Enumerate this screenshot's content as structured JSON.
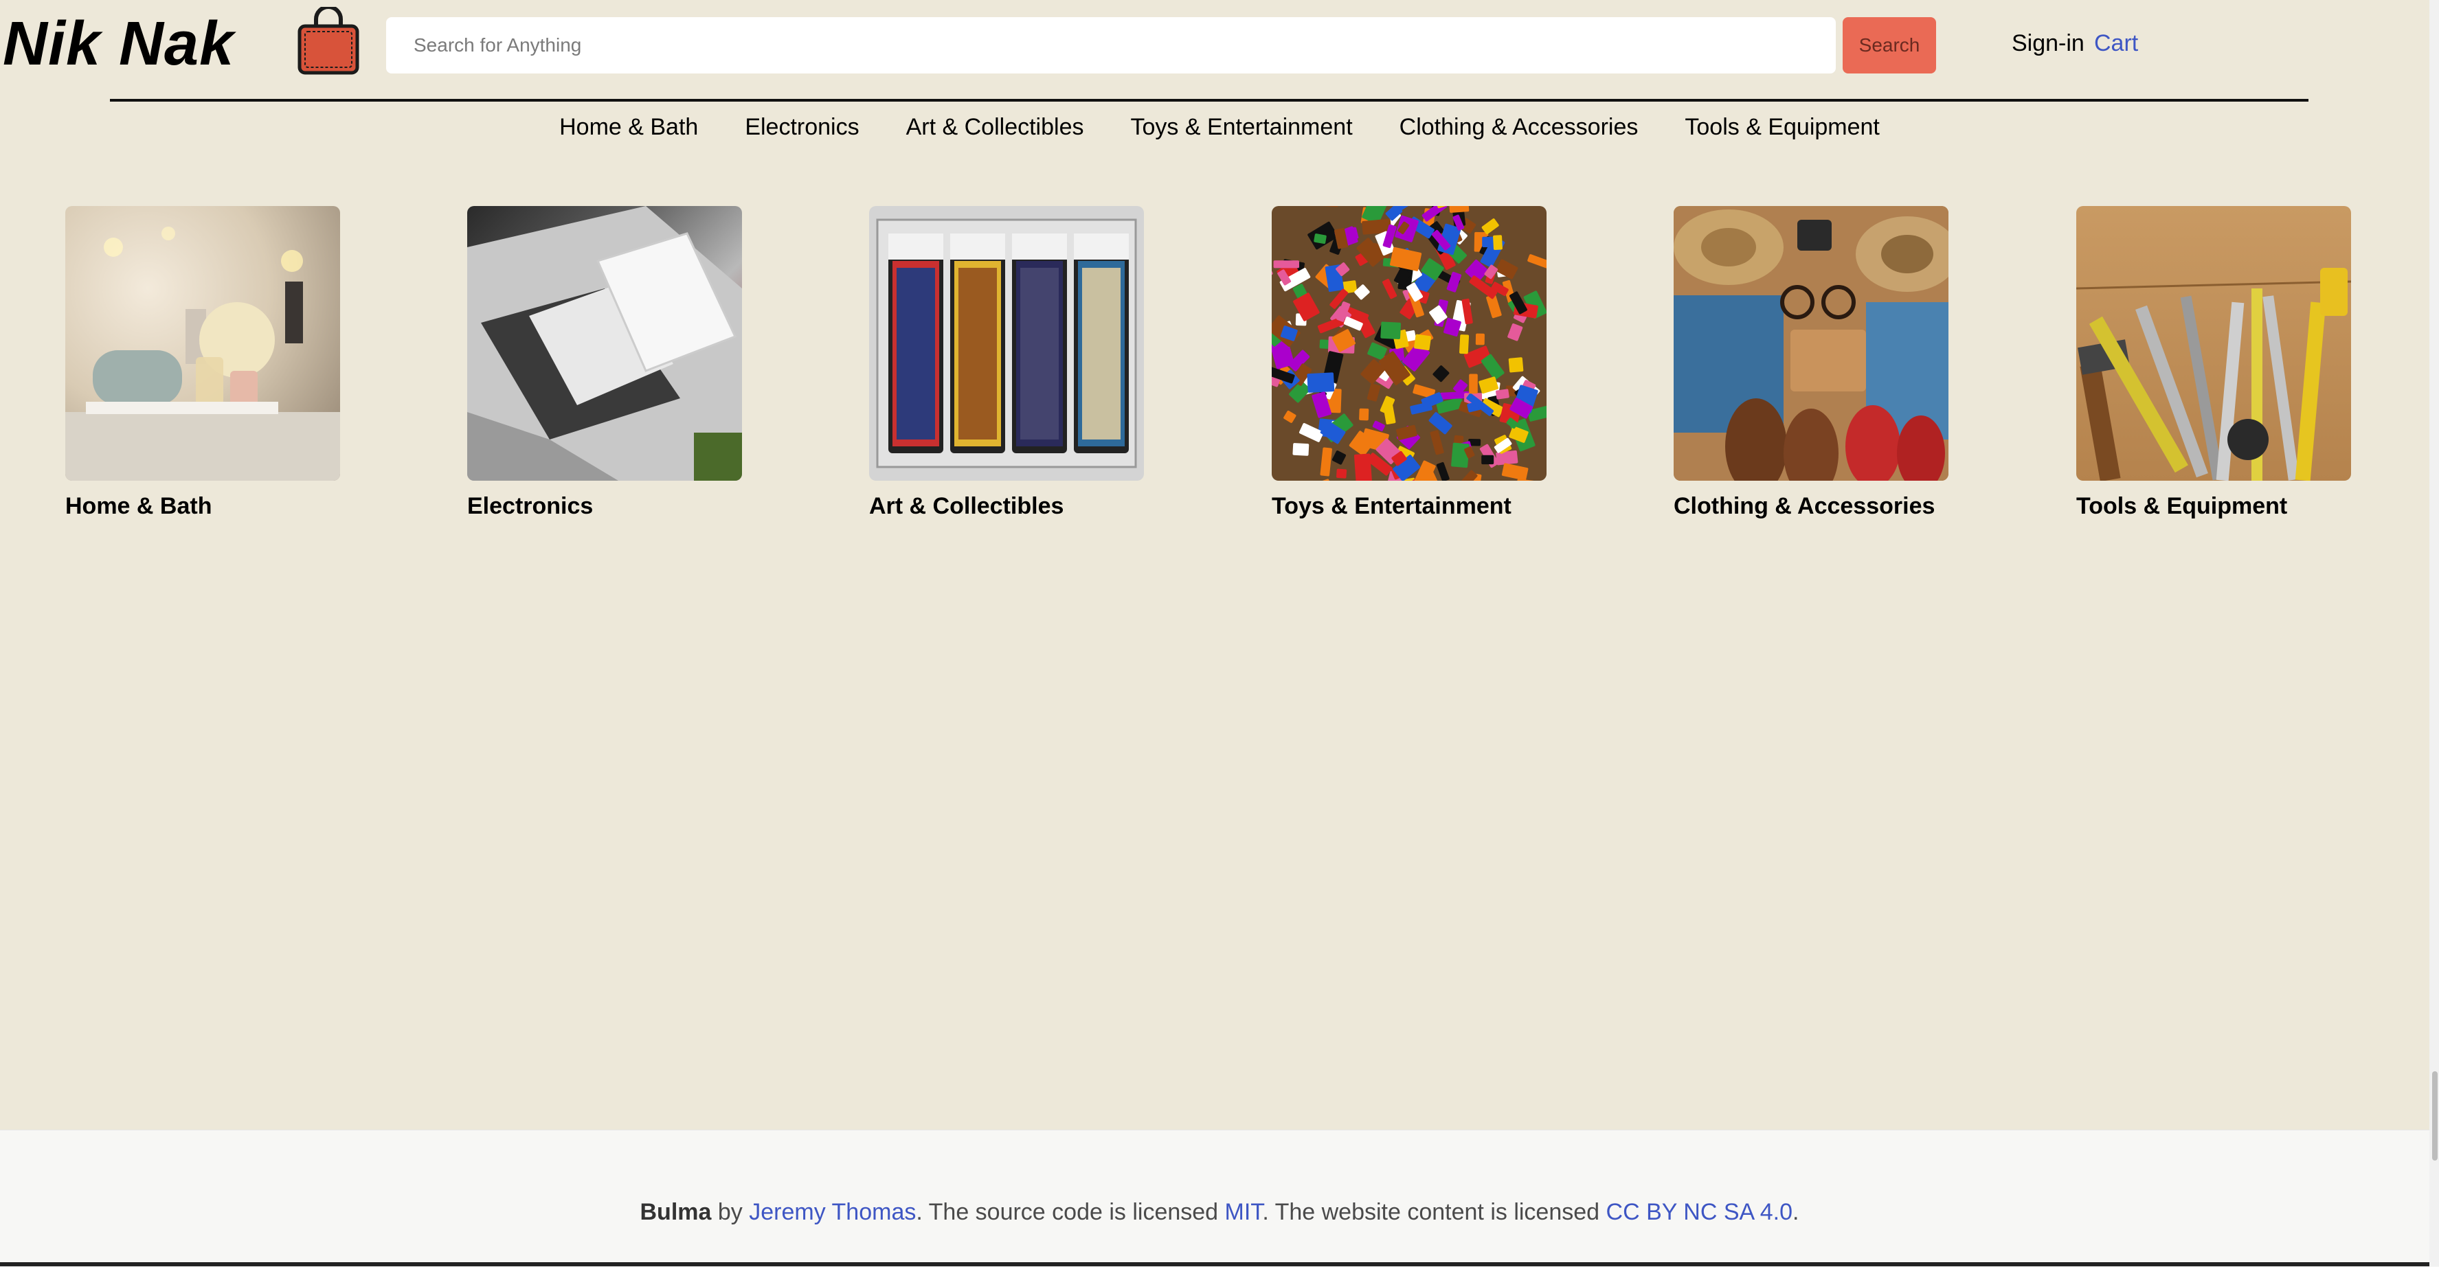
{
  "brand": {
    "name": "Nik Nak",
    "logo_icon": "shopping-bag-icon"
  },
  "search": {
    "placeholder": "Search for Anything",
    "value": "",
    "button_label": "Search"
  },
  "account": {
    "signin_label": "Sign-in",
    "cart_label": "Cart"
  },
  "nav": {
    "items": [
      {
        "label": "Home & Bath"
      },
      {
        "label": "Electronics"
      },
      {
        "label": "Art & Collectibles"
      },
      {
        "label": "Toys & Entertainment"
      },
      {
        "label": "Clothing & Accessories"
      },
      {
        "label": "Tools & Equipment"
      }
    ]
  },
  "categories": [
    {
      "label": "Home & Bath",
      "image": "spa-candles-towels-photo"
    },
    {
      "label": "Electronics",
      "image": "laptop-tablet-phone-photo"
    },
    {
      "label": "Art & Collectibles",
      "image": "graded-trading-cards-photo"
    },
    {
      "label": "Toys & Entertainment",
      "image": "lego-bricks-pile-photo"
    },
    {
      "label": "Clothing & Accessories",
      "image": "hats-shoes-jeans-flatlay-photo"
    },
    {
      "label": "Tools & Equipment",
      "image": "hand-tools-on-wood-photo"
    }
  ],
  "footer": {
    "brand": "Bulma",
    "by": " by ",
    "author": "Jeremy Thomas",
    "text1": ". The source code is licensed ",
    "license1": "MIT",
    "text2": ". The website content is licensed ",
    "license2": "CC BY NC SA 4.0",
    "text3": "."
  },
  "colors": {
    "background": "#ede8d9",
    "search_button": "#ea6a55",
    "link": "#3e56c4",
    "footer_bg": "#f7f7f5"
  }
}
